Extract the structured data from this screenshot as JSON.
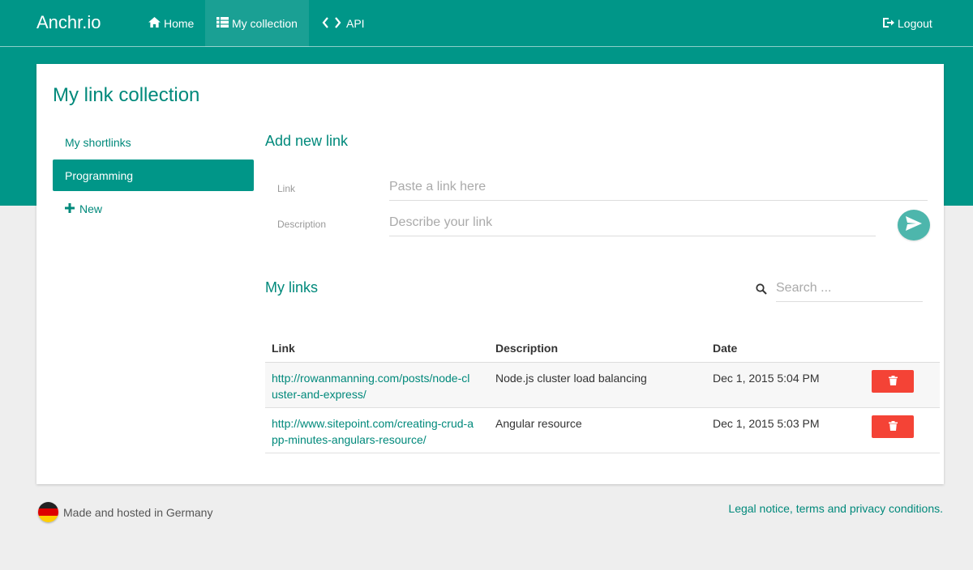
{
  "nav": {
    "brand": "Anchr.io",
    "items": [
      {
        "label": "Home",
        "icon": "home-icon"
      },
      {
        "label": "My collection",
        "icon": "list-icon"
      },
      {
        "label": "API",
        "icon": "code-icon"
      }
    ],
    "logout": "Logout"
  },
  "page": {
    "title": "My link collection"
  },
  "sidebar": {
    "items": [
      {
        "label": "My shortlinks"
      },
      {
        "label": "Programming"
      }
    ],
    "new_label": "New"
  },
  "add_link": {
    "title": "Add new link",
    "link_label": "Link",
    "link_placeholder": "Paste a link here",
    "description_label": "Description",
    "description_placeholder": "Describe your link"
  },
  "my_links": {
    "title": "My links",
    "search_placeholder": "Search ...",
    "columns": [
      "Link",
      "Description",
      "Date"
    ],
    "rows": [
      {
        "url": "http://rowanmanning.com/posts/node-cluster-and-express/",
        "description": "Node.js cluster load balancing",
        "date": "Dec 1, 2015 5:04 PM"
      },
      {
        "url": "http://www.sitepoint.com/creating-crud-app-minutes-angulars-resource/",
        "description": "Angular resource",
        "date": "Dec 1, 2015 5:03 PM"
      }
    ]
  },
  "footer": {
    "left_text": "Made and hosted in Germany",
    "right_text": "Legal notice, terms and privacy conditions."
  },
  "colors": {
    "primary": "#009688",
    "primary_text": "#00897b",
    "danger": "#f44336",
    "send_button": "#4db6ac"
  }
}
